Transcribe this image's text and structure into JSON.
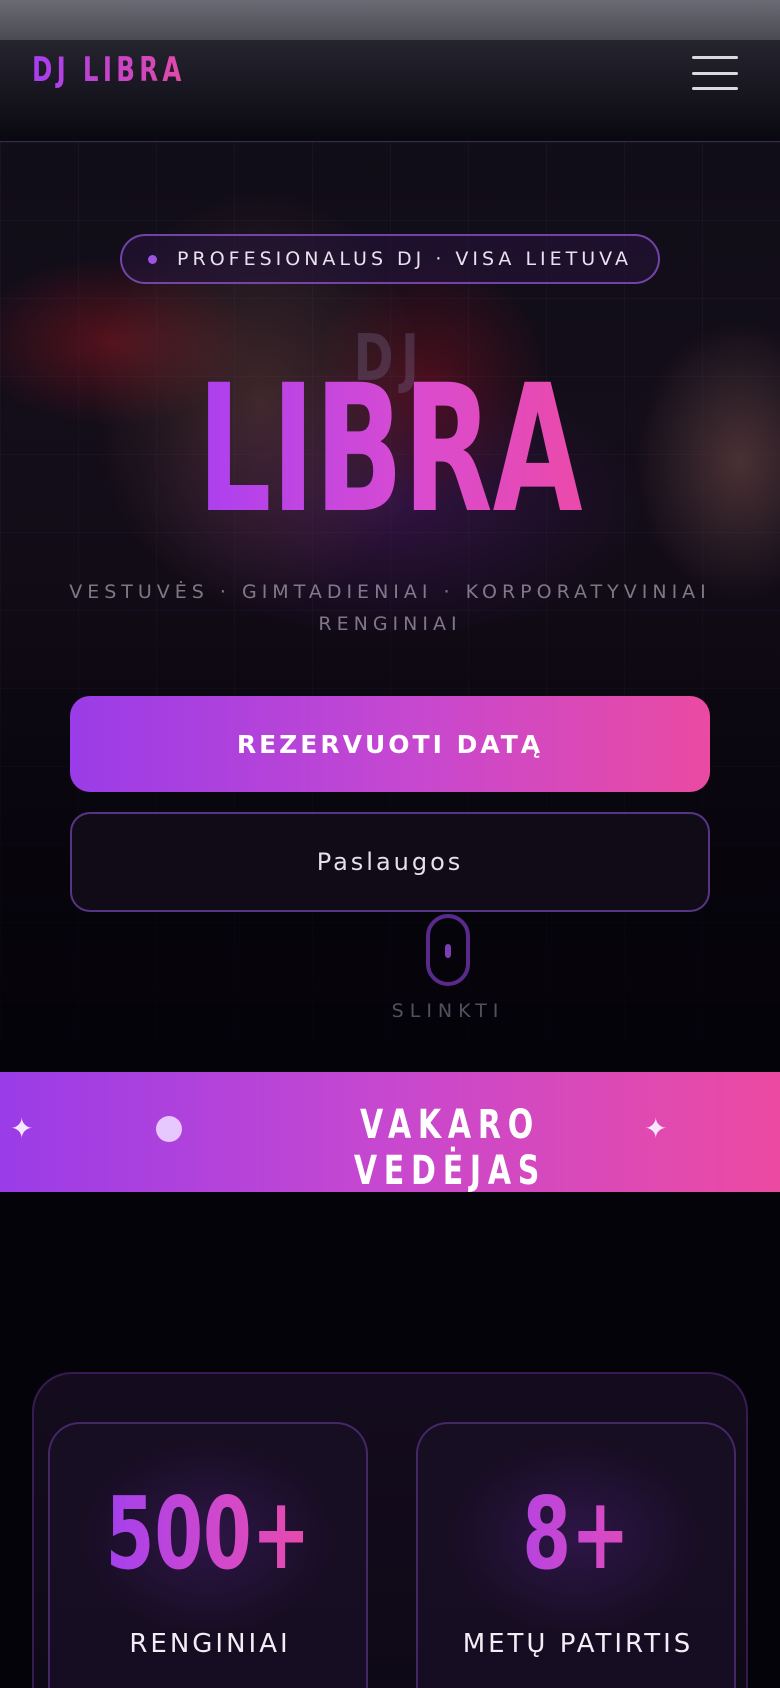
{
  "header": {
    "logo": "DJ LIBRA",
    "menu_icon": "hamburger-menu-icon"
  },
  "hero": {
    "tagline": "PROFESIONALUS DJ · VISA LIETUVA",
    "pre_title": "DJ",
    "title": "LIBRA",
    "subtitle": "VESTUVĖS · GIMTADIENIAI · KORPORATYVINIAI RENGINIAI",
    "primary_button": "REZERVUOTI DATĄ",
    "secondary_button": "Paslaugos",
    "scroll_label": "SLINKTI",
    "scroll_icon": "mouse-scroll-icon"
  },
  "banner": {
    "text": "VAKARO VEDĖJAS",
    "spark_icon": "sparkle-icon"
  },
  "stats": [
    {
      "value": "500+",
      "label": "RENGINIAI"
    },
    {
      "value": "8+",
      "label": "METŲ PATIRTIS"
    }
  ],
  "colors": {
    "accent_start": "#9a3ce8",
    "accent_end": "#ec4aa2",
    "background": "#05030a"
  }
}
